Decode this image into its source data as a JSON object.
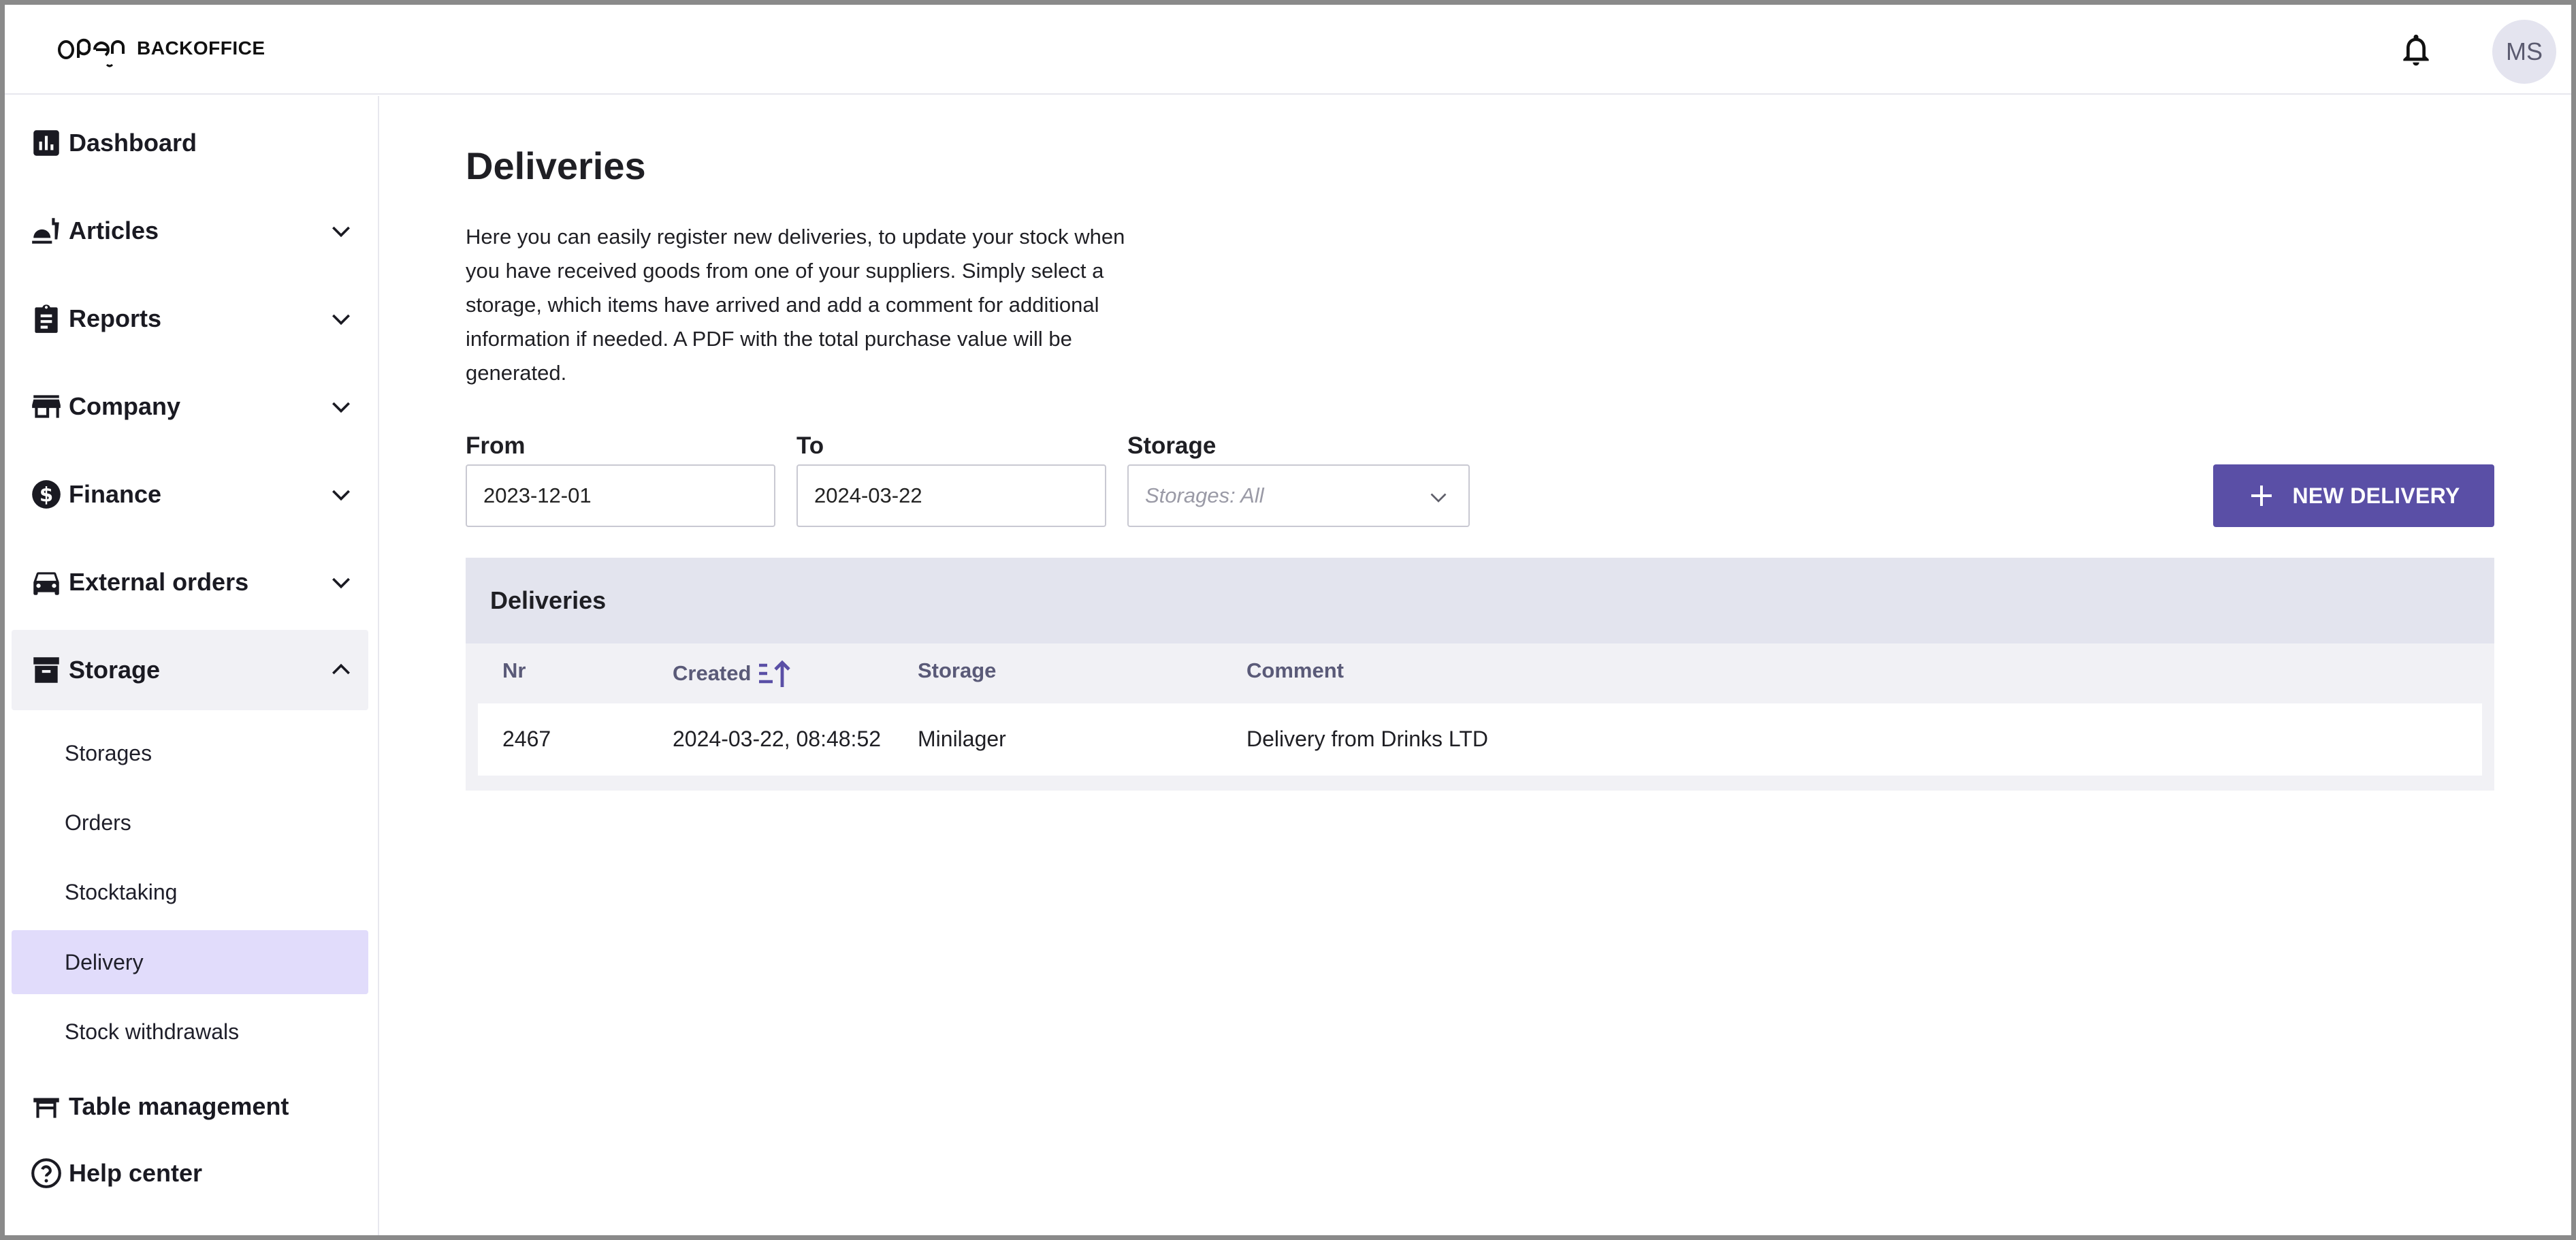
{
  "header": {
    "logo_text": "BACKOFFICE",
    "avatar_initials": "MS"
  },
  "sidebar": {
    "items": [
      {
        "label": "Dashboard",
        "icon": "bar-chart-icon"
      },
      {
        "label": "Articles",
        "icon": "food-icon"
      },
      {
        "label": "Reports",
        "icon": "clipboard-icon"
      },
      {
        "label": "Company",
        "icon": "store-icon"
      },
      {
        "label": "Finance",
        "icon": "dollar-icon"
      },
      {
        "label": "External orders",
        "icon": "car-icon"
      },
      {
        "label": "Storage",
        "icon": "archive-icon"
      },
      {
        "label": "Table management",
        "icon": "table-icon"
      },
      {
        "label": "Help center",
        "icon": "help-icon"
      }
    ],
    "storage_sub": [
      {
        "label": "Storages"
      },
      {
        "label": "Orders"
      },
      {
        "label": "Stocktaking"
      },
      {
        "label": "Delivery"
      },
      {
        "label": "Stock withdrawals"
      }
    ]
  },
  "main": {
    "title": "Deliveries",
    "intro": "Here you can easily register new deliveries, to update your stock when you have received goods from one of your suppliers. Simply select a storage, which items have arrived and add a comment for additional information if needed. A PDF with the total purchase value will be generated.",
    "filters": {
      "from_label": "From",
      "from_value": "2023-12-01",
      "to_label": "To",
      "to_value": "2024-03-22",
      "storage_label": "Storage",
      "storage_placeholder": "Storages: All"
    },
    "new_delivery_label": "NEW DELIVERY",
    "table": {
      "title": "Deliveries",
      "columns": [
        "Nr",
        "Created",
        "Storage",
        "Comment"
      ],
      "rows": [
        {
          "nr": "2467",
          "created": "2024-03-22, 08:48:52",
          "storage": "Minilager",
          "comment": "Delivery from Drinks LTD"
        }
      ]
    }
  },
  "colors": {
    "accent": "#5a4fa6",
    "active_sub_bg": "#e1dcfb",
    "table_header_bg": "#e3e4ee"
  }
}
